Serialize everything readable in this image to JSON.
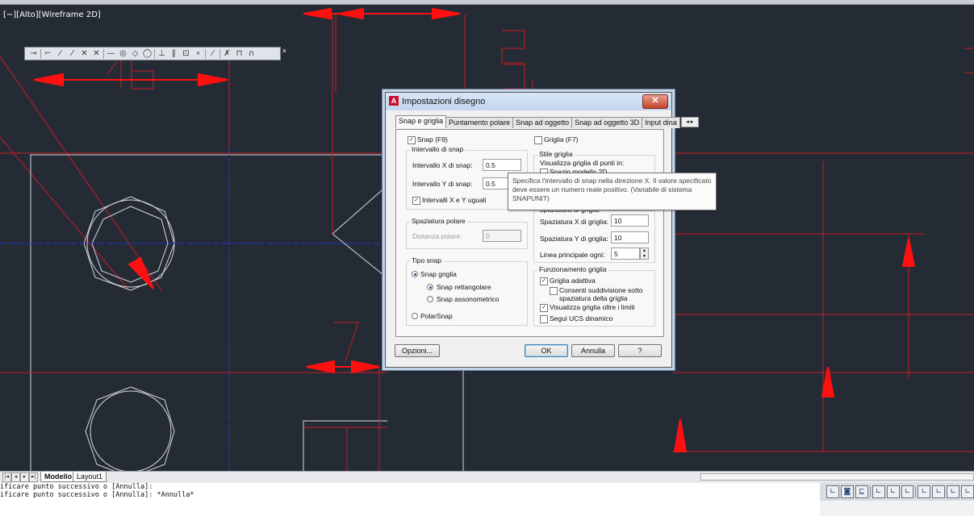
{
  "viewport": {
    "label": "[−][Alto][Wireframe 2D]"
  },
  "colors": {
    "background": "#252b35",
    "drawing_line": "#e0222a",
    "white_line": "#d6d9de",
    "center_line": "#1f3ad1",
    "dimension_arrow": "#ff1010",
    "annotation_circle": "#d4101a"
  },
  "osnap_toolbar": {
    "icons": [
      "temp-tracking-icon",
      "snap-from-icon",
      "endpoint-icon",
      "midpoint-icon",
      "intersection-icon",
      "apparent-intersection-icon",
      "extension-icon",
      "center-icon",
      "quadrant-icon",
      "tangent-icon",
      "perpendicular-icon",
      "parallel-icon",
      "insert-icon",
      "node-icon",
      "nearest-icon",
      "none-icon",
      "osnap-settings-icon",
      "magnet-icon"
    ],
    "glyphs": [
      "⊸",
      "⌐",
      "⁄",
      "⁄",
      "✕",
      "✕",
      "—",
      "◎",
      "◇",
      "◯",
      "⊥",
      "∥",
      "⊡",
      "∘",
      "⁄",
      "✗",
      "⊓",
      "∩"
    ],
    "close": "×"
  },
  "dialog": {
    "title": "Impostazioni disegno",
    "close": "✕",
    "tabs": [
      {
        "label": "Snap e griglia",
        "active": true
      },
      {
        "label": "Puntamento polare",
        "active": false
      },
      {
        "label": "Snap ad oggetto",
        "active": false
      },
      {
        "label": "Snap ad oggetto 3D",
        "active": false
      },
      {
        "label": "Input dina",
        "active": false
      }
    ],
    "tab_scroll": "◂ ▸",
    "snap": {
      "label": "Snap (F9)",
      "checked": true
    },
    "snap_interval": {
      "group": "Intervallo di snap",
      "x_label": "Intervallo X di snap:",
      "x_value": "0.5",
      "y_label": "Intervallo Y di snap:",
      "y_value": "0.5",
      "equal_label": "Intervalli X e Y uguali",
      "equal_checked": true
    },
    "polar_spacing": {
      "group": "Spaziatura polare",
      "label": "Distanza polare:",
      "value": "0"
    },
    "snap_type": {
      "group": "Tipo snap",
      "grid_snap": "Snap griglia",
      "rect_snap": "Snap rettangolare",
      "iso_snap": "Snap assonometrico",
      "polar_snap": "PolarSnap"
    },
    "grid": {
      "label": "Griglia (F7)",
      "checked": false
    },
    "grid_style": {
      "group": "Stile griglia",
      "desc": "Visualizza griglia di punti in:",
      "model_space": "Spazio modello 2D"
    },
    "grid_spacing": {
      "group": "Spaziatura di griglia",
      "x_label": "Spaziatura X di griglia:",
      "x_value": "10",
      "y_label": "Spaziatura Y di griglia:",
      "y_value": "10",
      "major_label": "Linea principale ogni:",
      "major_value": "5"
    },
    "grid_behavior": {
      "group": "Funzionamento griglia",
      "adaptive": "Griglia adattiva",
      "subdivide": "Consenti suddivisione sotto",
      "subdivide2": "spaziatura della griglia",
      "beyond": "Visualizza griglia oltre i limiti",
      "ucs": "Segui UCS dinamico"
    },
    "buttons": {
      "options": "Opzioni...",
      "ok": "OK",
      "cancel": "Annulla",
      "help": "?"
    }
  },
  "tooltip": {
    "line1": "Specifica l'intervallo di snap nella direzione X. Il valore specificato",
    "line2": "deve essere un numero reale positivo. (Variabile di sistema",
    "line3": "SNAPUNIT)"
  },
  "layout_tabs": {
    "nav": [
      "|◂",
      "◂",
      "▸",
      "▸|"
    ],
    "model": "Modello",
    "layout1": "Layout1"
  },
  "command_line": [
    "ificare punto successivo o [Annulla]:",
    "ificare punto successivo o [Annulla]: *Annulla*"
  ],
  "status_icons": [
    "∟",
    "◙",
    "⊑",
    "∟",
    "∟",
    "∟",
    "∟",
    "∟",
    "∟",
    "∟"
  ]
}
